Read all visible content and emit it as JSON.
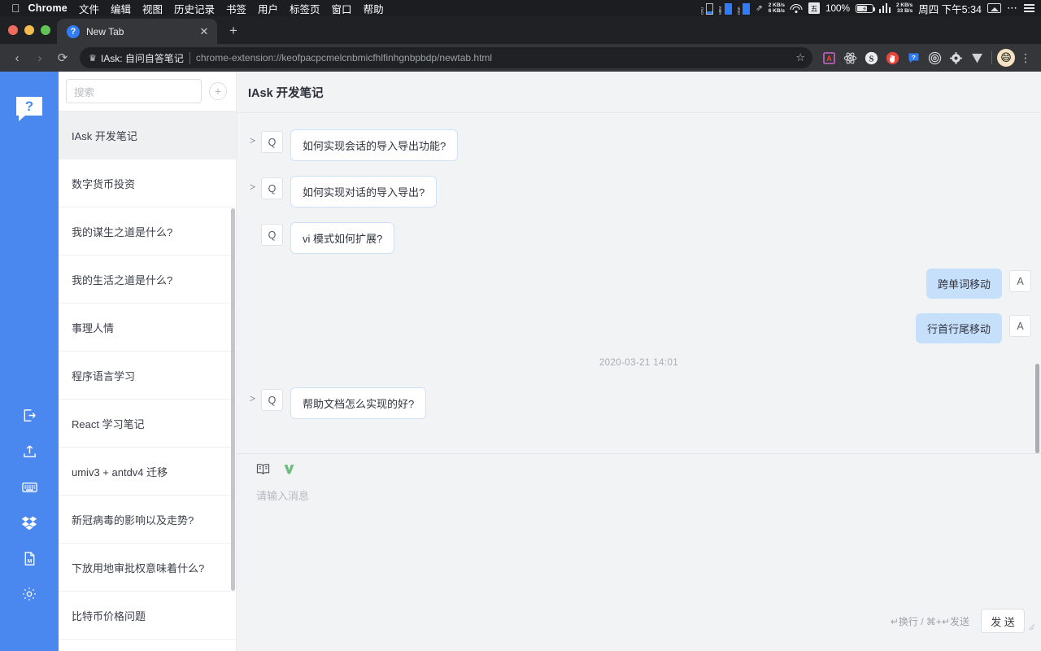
{
  "menubar": {
    "apple_icon": "apple-icon",
    "app_name": "Chrome",
    "menus": [
      "文件",
      "编辑",
      "视图",
      "历史记录",
      "书签",
      "用户",
      "标签页",
      "窗口",
      "帮助"
    ],
    "status": {
      "cpu_label": "CPU",
      "mem_label": "MEM",
      "disk_label": "DISK",
      "net_up": "2 KB/s",
      "net_down": "6 KB/s",
      "ime": "五",
      "battery_percent": "100%",
      "traffic_up": "2 KB/s",
      "traffic_down": "33 B/s",
      "clock": "周四 下午5:34"
    }
  },
  "browser": {
    "tab": {
      "title": "New Tab",
      "favicon": "?",
      "close_label": "✕"
    },
    "new_tab_label": "+",
    "nav": {
      "back": "‹",
      "forward": "›",
      "reload": "⟳"
    },
    "omnibox": {
      "extension_name": "IAsk: 自问自答笔记",
      "url": "chrome-extension://keofpacpcmelcnbmicfhlfinhgnbpbdp/newtab.html",
      "star": "☆"
    },
    "profile_avatar": "😄",
    "menu_label": "⋮"
  },
  "rail": {
    "logo": "?",
    "icons": [
      "export-icon",
      "upload-icon",
      "keyboard-icon",
      "dropbox-icon",
      "markdown-file-icon",
      "settings-gear-icon"
    ]
  },
  "sidebar": {
    "search_placeholder": "搜索",
    "search_value": "",
    "add_label": "+",
    "items": [
      {
        "label": "IAsk 开发笔记",
        "active": true
      },
      {
        "label": "数字货币投资",
        "active": false
      },
      {
        "label": "我的谋生之道是什么?",
        "active": false
      },
      {
        "label": "我的生活之道是什么?",
        "active": false
      },
      {
        "label": "事理人情",
        "active": false
      },
      {
        "label": "程序语言学习",
        "active": false
      },
      {
        "label": "React 学习笔记",
        "active": false
      },
      {
        "label": "umiv3 + antdv4 迁移",
        "active": false
      },
      {
        "label": "新冠病毒的影响以及走势?",
        "active": false
      },
      {
        "label": "下放用地审批权意味着什么?",
        "active": false
      },
      {
        "label": "比特币价格问题",
        "active": false
      }
    ]
  },
  "main": {
    "title": "IAsk 开发笔记",
    "messages": [
      {
        "kind": "question",
        "badge": "Q",
        "text": "如何实现会话的导入导出功能?",
        "expandable": true
      },
      {
        "kind": "question",
        "badge": "Q",
        "text": "如何实现对话的导入导出?",
        "expandable": true
      },
      {
        "kind": "question",
        "badge": "Q",
        "text": "vi 模式如何扩展?",
        "expandable": false
      },
      {
        "kind": "answer",
        "badge": "A",
        "text": "跨单词移动"
      },
      {
        "kind": "answer",
        "badge": "A",
        "text": "行首行尾移动"
      },
      {
        "kind": "timestamp",
        "text": "2020-03-21 14:01"
      },
      {
        "kind": "question",
        "badge": "Q",
        "text": "帮助文档怎么实现的好?",
        "expandable": true
      }
    ]
  },
  "composer": {
    "tools": [
      "dictionary-book-icon",
      "vim-mode-icon"
    ],
    "placeholder": "请输入消息",
    "value": "",
    "hint": "↵换行 / ⌘+↵发送",
    "send_label": "发 送"
  },
  "colors": {
    "rail_blue": "#4a87ee",
    "answer_bubble": "#c6dffb",
    "question_border": "#cfe1f7",
    "app_bg": "#f2f3f5"
  }
}
